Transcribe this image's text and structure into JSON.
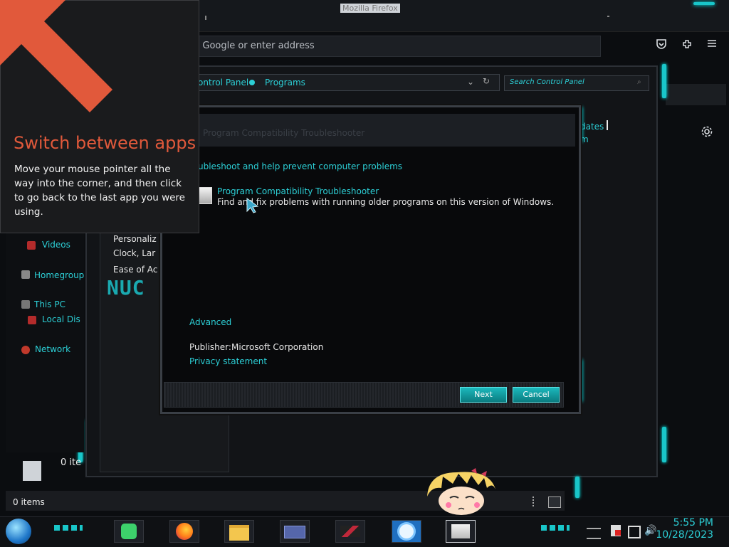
{
  "browser": {
    "window_title": "Mozilla Firefox",
    "address_placeholder": "n Google or enter address"
  },
  "control_panel": {
    "breadcrumb_parent": "ontrol Panel",
    "breadcrumb_current": "Programs",
    "search_placeholder": "Search Control Panel",
    "right_links": [
      "dates",
      "m"
    ],
    "left_items": [
      "Personaliz",
      "Clock, Lar",
      "Ease of Ac"
    ]
  },
  "dialog": {
    "title": "Program Compatibility Troubleshooter",
    "header_text": "ubleshoot and help prevent computer problems",
    "item_title": "Program Compatibility Troubleshooter",
    "item_desc": "Find and fix problems with running older programs on this version of Windows.",
    "advanced_link": "Advanced",
    "publisher_label": "Publisher:",
    "publisher_value": "Microsoft Corporation",
    "privacy_link": "Privacy statement",
    "next_button": "Next",
    "cancel_button": "Cancel"
  },
  "explorer": {
    "nav_items": [
      {
        "label": "Videos"
      },
      {
        "label": "Homegroup"
      },
      {
        "label": "This PC"
      },
      {
        "label": "Local Dis"
      },
      {
        "label": "Network"
      }
    ],
    "item_count_right": "0 ite",
    "status_items": "0 items"
  },
  "tip": {
    "title": "Switch between apps",
    "body": "Move your mouse pointer all the way into the corner, and then click to go back to the last app you were using."
  },
  "taskbar": {
    "time": "5:55 PM",
    "date": "10/28/2023",
    "apps": [
      "spotify-icon",
      "firefox-icon",
      "file-explorer-icon",
      "control-panel-icon",
      "app-red-icon",
      "settings-sun-icon",
      "troubleshooter-icon"
    ]
  },
  "colors": {
    "accent_cyan": "#2ccfd6",
    "tip_orange": "#e1593b"
  }
}
